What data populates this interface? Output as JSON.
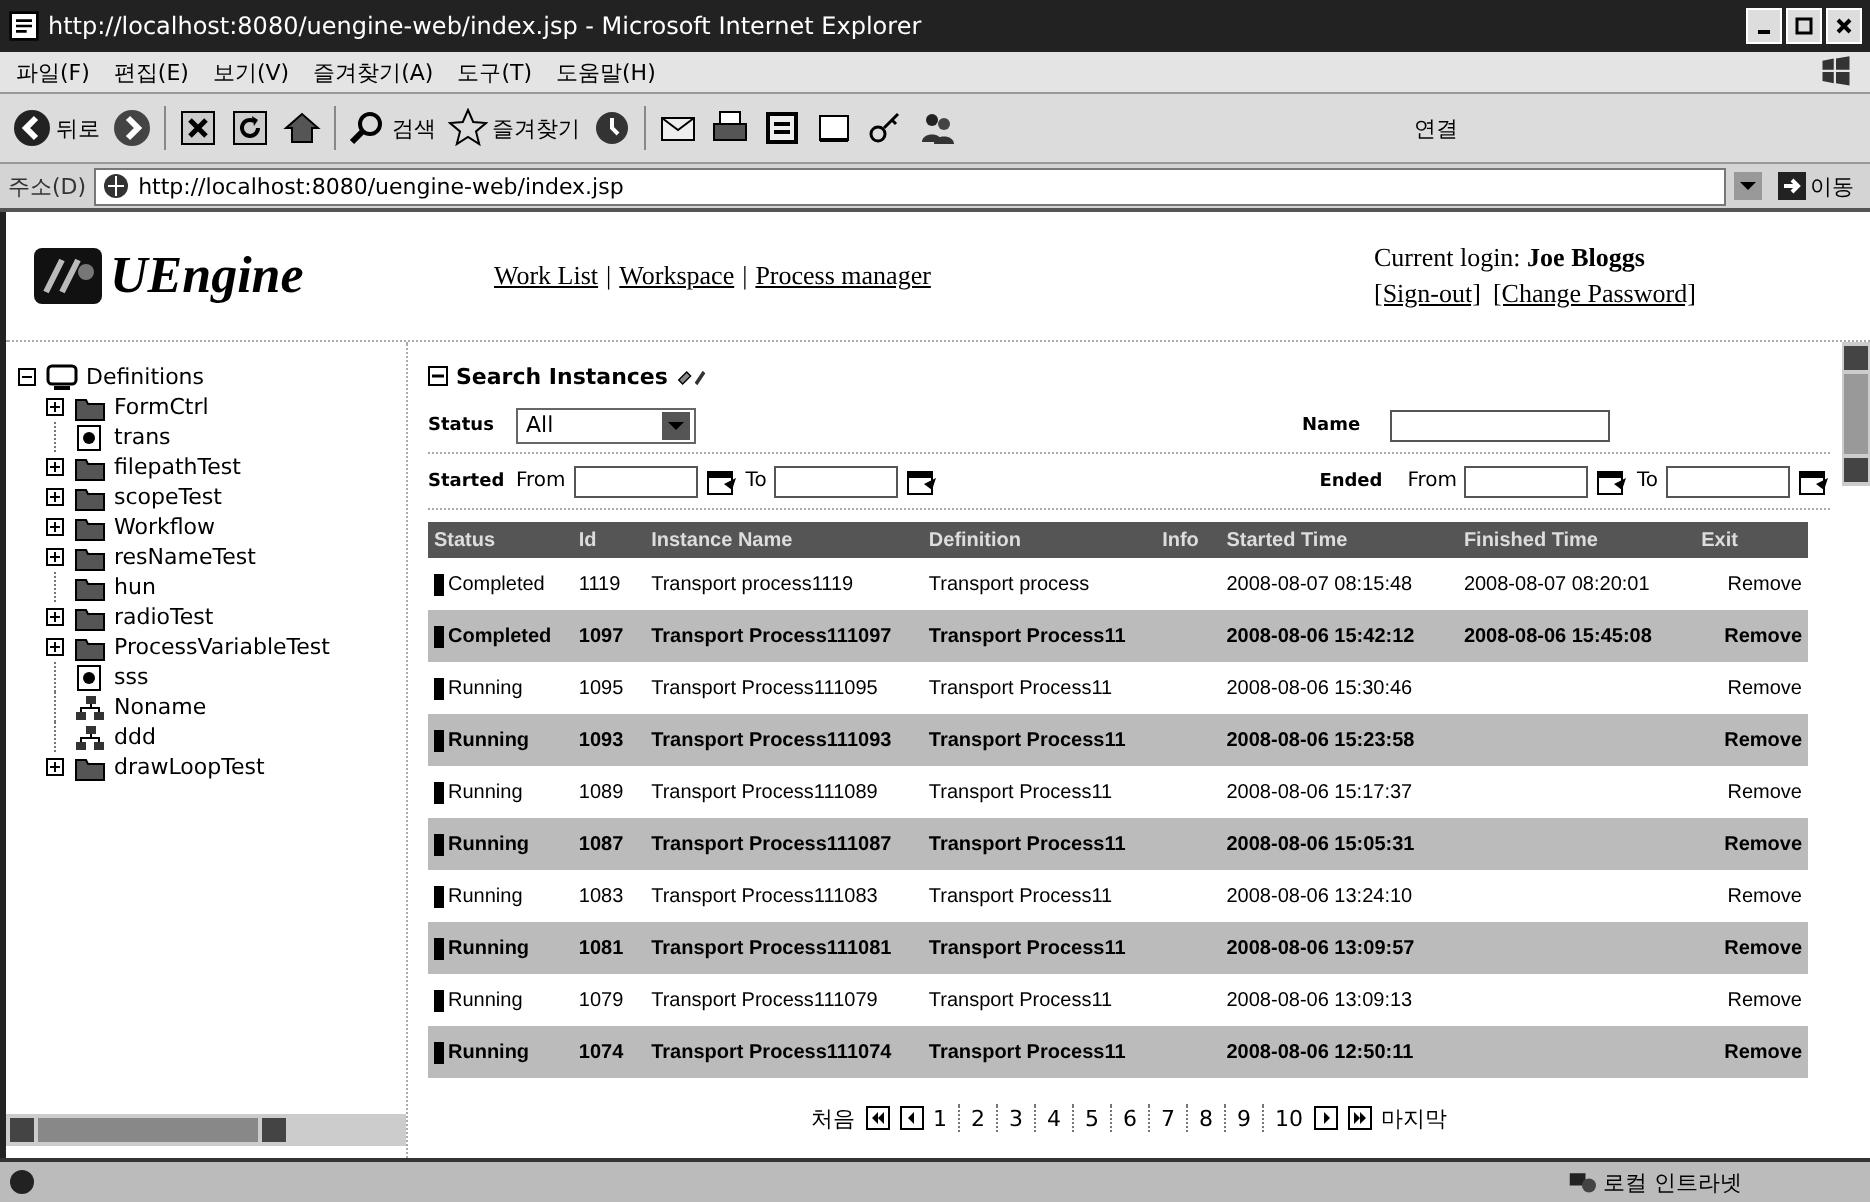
{
  "window": {
    "title": "http://localhost:8080/uengine-web/index.jsp - Microsoft Internet Explorer"
  },
  "menu": [
    "파일(F)",
    "편집(E)",
    "보기(V)",
    "즐겨찾기(A)",
    "도구(T)",
    "도움말(H)"
  ],
  "toolbar": {
    "back": "뒤로",
    "search": "검색",
    "favorites": "즐겨찾기",
    "links": "연결"
  },
  "address": {
    "label": "주소(D)",
    "url": "http://localhost:8080/uengine-web/index.jsp",
    "go": "이동"
  },
  "header": {
    "logo": "UEngine",
    "nav": [
      {
        "kind": "link",
        "text": "Work List"
      },
      {
        "kind": "separator",
        "text": "|"
      },
      {
        "kind": "link",
        "text": "Workspace"
      },
      {
        "kind": "separator",
        "text": "|"
      },
      {
        "kind": "link",
        "text": "Process manager"
      }
    ],
    "login": "Current login: **Joe Bloggs**",
    "links": [
      "[Sign-out]",
      "[Change Password]"
    ]
  },
  "tree": {
    "label": "Definitions",
    "expanded": true,
    "children": [
      {
        "label": "FormCtrl",
        "kind": "folder",
        "expandable": true
      },
      {
        "label": "trans",
        "kind": "form",
        "expandable": false
      },
      {
        "label": "filepathTest",
        "kind": "folder",
        "expandable": true
      },
      {
        "label": "scopeTest",
        "kind": "folder",
        "expandable": true
      },
      {
        "label": "Workflow",
        "kind": "folder",
        "expandable": true
      },
      {
        "label": "resNameTest",
        "kind": "folder",
        "expandable": true
      },
      {
        "label": "hun",
        "kind": "folder",
        "expandable": false
      },
      {
        "label": "radioTest",
        "kind": "folder",
        "expandable": true
      },
      {
        "label": "ProcessVariableTest",
        "kind": "folder",
        "expandable": true
      },
      {
        "label": "sss",
        "kind": "form",
        "expandable": false
      },
      {
        "label": "Noname",
        "kind": "process",
        "expandable": false
      },
      {
        "label": "ddd",
        "kind": "process",
        "expandable": false
      },
      {
        "label": "drawLoopTest",
        "kind": "folder",
        "expandable": true
      }
    ]
  },
  "search": {
    "title": "Search Instances",
    "status_label": "Status",
    "status_value": "All",
    "name_label": "Name",
    "started_label": "Started",
    "ended_label": "Ended",
    "started_from": "From",
    "started_to": "To",
    "ended_from": "From",
    "ended_to": "To"
  },
  "table": {
    "columns": [
      "Status",
      "Id",
      "Instance Name",
      "Definition",
      "Info",
      "Started Time",
      "Finished Time",
      "Exit"
    ],
    "rows": [
      {
        "status": "Completed",
        "id": "1119",
        "name": "Transport process1119",
        "definition": "Transport process",
        "started": "2008-08-07 08:15:48",
        "finished": "2008-08-07 08:20:01",
        "action": "Remove"
      },
      {
        "status": "Completed",
        "id": "1097",
        "name": "Transport Process111097",
        "definition": "Transport Process11",
        "started": "2008-08-06 15:42:12",
        "finished": "2008-08-06 15:45:08",
        "action": "Remove"
      },
      {
        "status": "Running",
        "id": "1095",
        "name": "Transport Process111095",
        "definition": "Transport Process11",
        "started": "2008-08-06 15:30:46",
        "action": "Remove"
      },
      {
        "status": "Running",
        "id": "1093",
        "name": "Transport Process111093",
        "definition": "Transport Process11",
        "started": "2008-08-06 15:23:58",
        "action": "Remove"
      },
      {
        "status": "Running",
        "id": "1089",
        "name": "Transport Process111089",
        "definition": "Transport Process11",
        "started": "2008-08-06 15:17:37",
        "action": "Remove"
      },
      {
        "status": "Running",
        "id": "1087",
        "name": "Transport Process111087",
        "definition": "Transport Process11",
        "started": "2008-08-06 15:05:31",
        "action": "Remove"
      },
      {
        "status": "Running",
        "id": "1083",
        "name": "Transport Process111083",
        "definition": "Transport Process11",
        "started": "2008-08-06 13:24:10",
        "action": "Remove"
      },
      {
        "status": "Running",
        "id": "1081",
        "name": "Transport Process111081",
        "definition": "Transport Process11",
        "started": "2008-08-06 13:09:57",
        "action": "Remove"
      },
      {
        "status": "Running",
        "id": "1079",
        "name": "Transport Process111079",
        "definition": "Transport Process11",
        "started": "2008-08-06 13:09:13",
        "action": "Remove"
      },
      {
        "status": "Running",
        "id": "1074",
        "name": "Transport Process111074",
        "definition": "Transport Process11",
        "started": "2008-08-06 12:50:11",
        "action": "Remove"
      }
    ]
  },
  "pagination": {
    "first": "처음",
    "pages": [
      "1",
      "2",
      "3",
      "4",
      "5",
      "6",
      "7",
      "8",
      "9",
      "10"
    ],
    "last": "마지막"
  },
  "status_bar": {
    "zone": "로컬 인트라넷"
  }
}
